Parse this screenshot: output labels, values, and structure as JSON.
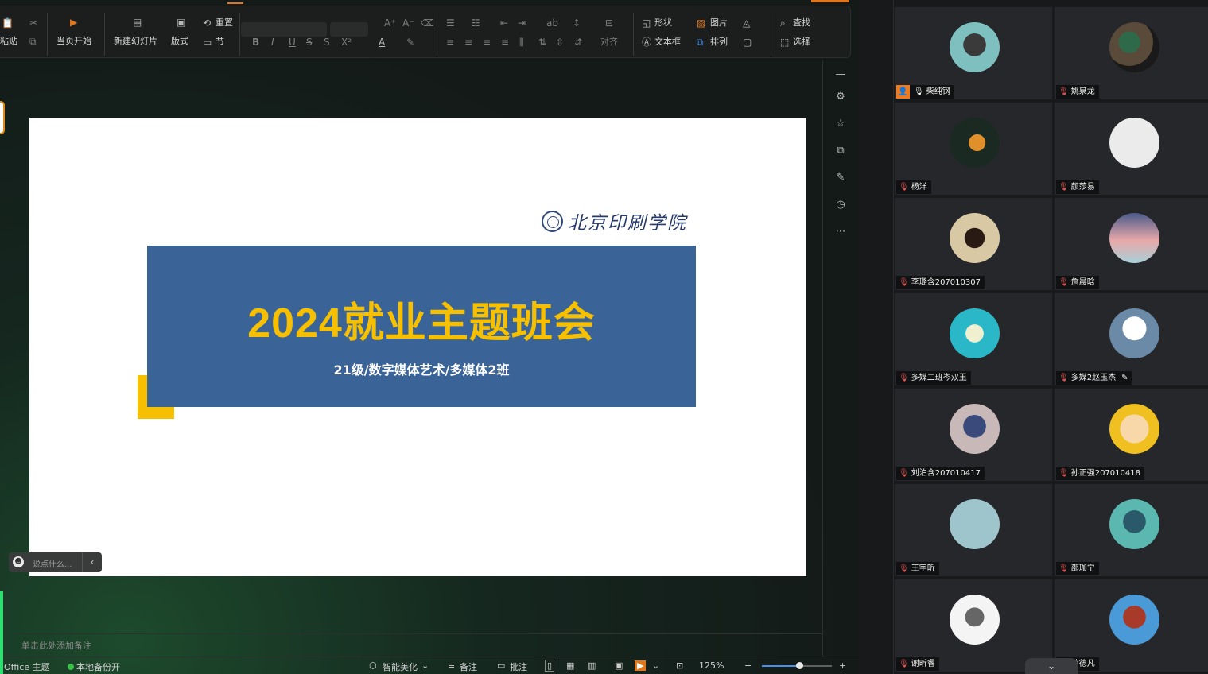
{
  "ribbon": {
    "paste_label": "粘贴",
    "start_here_label": "当页开始",
    "new_slide_label": "新建幻灯片",
    "layout_label": "版式",
    "reset_label": "重置",
    "section_label": "节",
    "align_label": "对齐",
    "shape_label": "形状",
    "image_label": "图片",
    "textbox_label": "文本框",
    "arrange_label": "排列",
    "find_label": "查找",
    "select_label": "选择",
    "format_icons": {
      "bold": "B",
      "italic": "I",
      "underline": "U",
      "strike": "S",
      "double_strike": "S",
      "superscript": "X²",
      "font_color": "A"
    }
  },
  "slide": {
    "logo_text": "北京印刷学院",
    "title": "2024就业主题班会",
    "subtitle": "21级/数字媒体艺术/多媒体2班",
    "accent_color": "#f6c000",
    "banner_color": "#3a6397"
  },
  "chat": {
    "placeholder": "说点什么..."
  },
  "notes": {
    "placeholder": "单击此处添加备注"
  },
  "status": {
    "theme": "Office 主题",
    "backup": "本地备份开",
    "beautify": "智能美化",
    "notes_btn": "备注",
    "comments_btn": "批注",
    "zoom": "125%"
  },
  "participants": [
    {
      "name": "柴纯钢",
      "host": true,
      "mic": "on"
    },
    {
      "name": "姚泉龙",
      "mic": "muted"
    },
    {
      "name": "杨洋",
      "mic": "muted"
    },
    {
      "name": "颜莎易",
      "mic": "muted"
    },
    {
      "name": "李璐含207010307",
      "mic": "muted"
    },
    {
      "name": "詹晨晗",
      "mic": "muted"
    },
    {
      "name": "多媒二班岑双玉",
      "mic": "muted"
    },
    {
      "name": "多媒2赵玉杰",
      "mic": "muted",
      "editing": true
    },
    {
      "name": "刘泊含207010417",
      "mic": "muted"
    },
    {
      "name": "孙正强207010418",
      "mic": "muted"
    },
    {
      "name": "王宇昕",
      "mic": "muted"
    },
    {
      "name": "邵珈宁",
      "mic": "muted"
    },
    {
      "name": "谢昕睿",
      "mic": "muted"
    },
    {
      "name": "黄德凡",
      "mic": "muted"
    }
  ]
}
